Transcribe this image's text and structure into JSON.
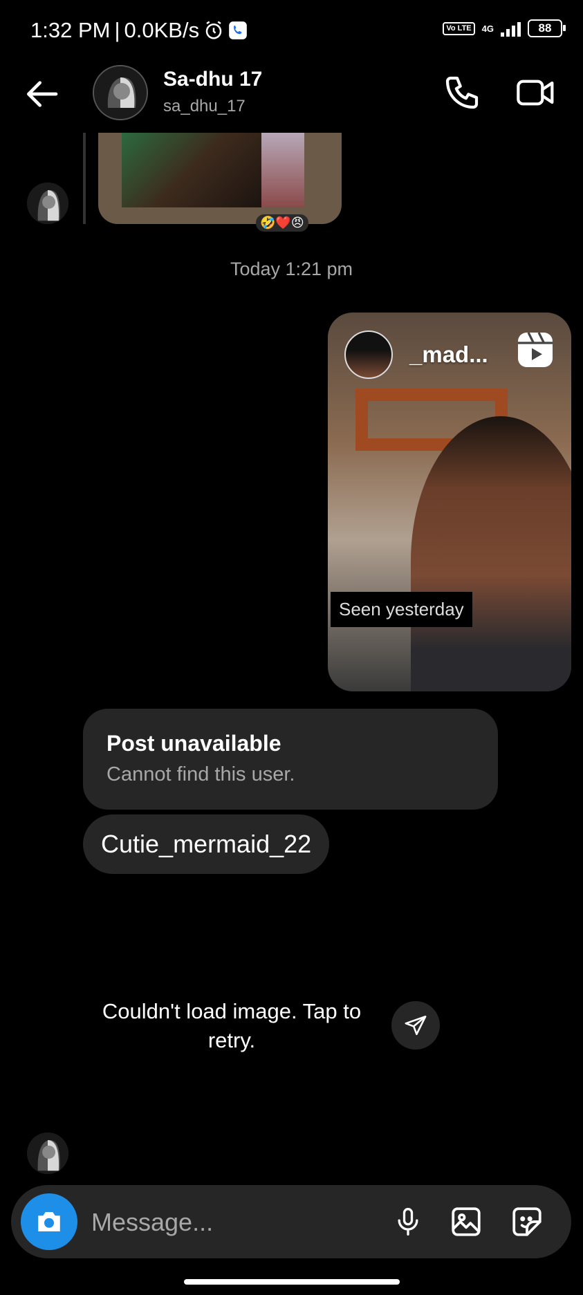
{
  "status_bar": {
    "time": "1:32 PM",
    "separator": "|",
    "speed": "0.0KB/s",
    "volte": "Vo LTE",
    "network": "4G",
    "battery": "88"
  },
  "header": {
    "name": "Sa-dhu 17",
    "username": "sa_dhu_17"
  },
  "thread": {
    "reactions": "🤣❤️😠",
    "timestamp": "Today 1:21 pm",
    "reel": {
      "username": "_mad...",
      "seen_label": "Seen yesterday"
    },
    "post_unavailable": {
      "title": "Post unavailable",
      "subtitle": "Cannot find this user."
    },
    "username_message": "Cutie_mermaid_22",
    "load_error": "Couldn't load image. Tap to retry."
  },
  "composer": {
    "placeholder": "Message..."
  },
  "colors": {
    "background": "#000000",
    "bubble": "#262626",
    "accent": "#1e8fe8",
    "muted_text": "#a8a8a8"
  },
  "icons": [
    "back-arrow-icon",
    "phone-icon",
    "video-camera-icon",
    "reels-icon",
    "send-icon",
    "camera-icon",
    "microphone-icon",
    "gallery-icon",
    "sticker-icon"
  ]
}
